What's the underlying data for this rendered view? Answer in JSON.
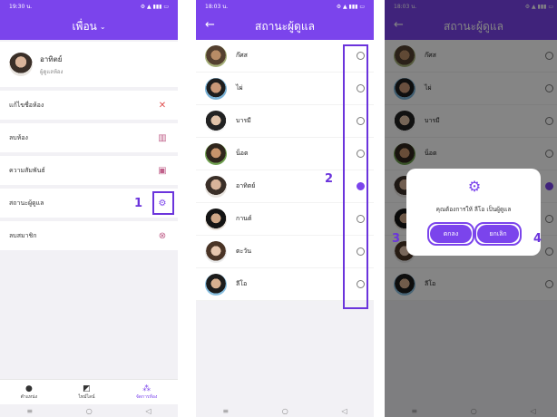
{
  "colors": {
    "accent": "#7b44ec",
    "annotation": "#6b34dc"
  },
  "phone1": {
    "status_time": "19:30 น.",
    "title": "เพื่อน",
    "user": {
      "name": "อาทิตย์",
      "subtitle": "ผู้ดูแลห้อง"
    },
    "menu": [
      {
        "label": "แก้ไขชื่อห้อง",
        "icon": "wrench-icon"
      },
      {
        "label": "ลบห้อง",
        "icon": "trash-icon"
      },
      {
        "label": "ความสัมพันธ์",
        "icon": "contact-card-icon"
      },
      {
        "label": "สถานะผู้ดูแล",
        "icon": "admin-user-gear-icon"
      },
      {
        "label": "ลบสมาชิก",
        "icon": "close-circle-icon"
      }
    ],
    "bottom_nav": [
      {
        "label": "ตำแหน่ง",
        "icon": "location-pin-icon"
      },
      {
        "label": "ไทม์ไลน์",
        "icon": "timeline-icon"
      },
      {
        "label": "จัดการห้อง",
        "icon": "manage-group-icon"
      }
    ],
    "annotation": "1"
  },
  "phone2": {
    "status_time": "18:03 น.",
    "title": "สถานะผู้ดูแล",
    "members": [
      {
        "name": "ก๊ศส",
        "selected": false
      },
      {
        "name": "ไผ่",
        "selected": false
      },
      {
        "name": "บารมี",
        "selected": false
      },
      {
        "name": "น็อต",
        "selected": false
      },
      {
        "name": "อาทิตย์",
        "selected": true
      },
      {
        "name": "กานต์",
        "selected": false
      },
      {
        "name": "ตะวัน",
        "selected": false
      },
      {
        "name": "ลีโอ",
        "selected": false
      }
    ],
    "annotation": "2"
  },
  "phone3": {
    "status_time": "18:03 น.",
    "title": "สถานะผู้ดูแล",
    "dialog": {
      "message": "คุณต้องการให้ ลีโอ เป็นผู้ดูแล",
      "confirm_label": "ตกลง",
      "cancel_label": "ยกเลิก"
    },
    "annotation_confirm": "3",
    "annotation_cancel": "4"
  }
}
